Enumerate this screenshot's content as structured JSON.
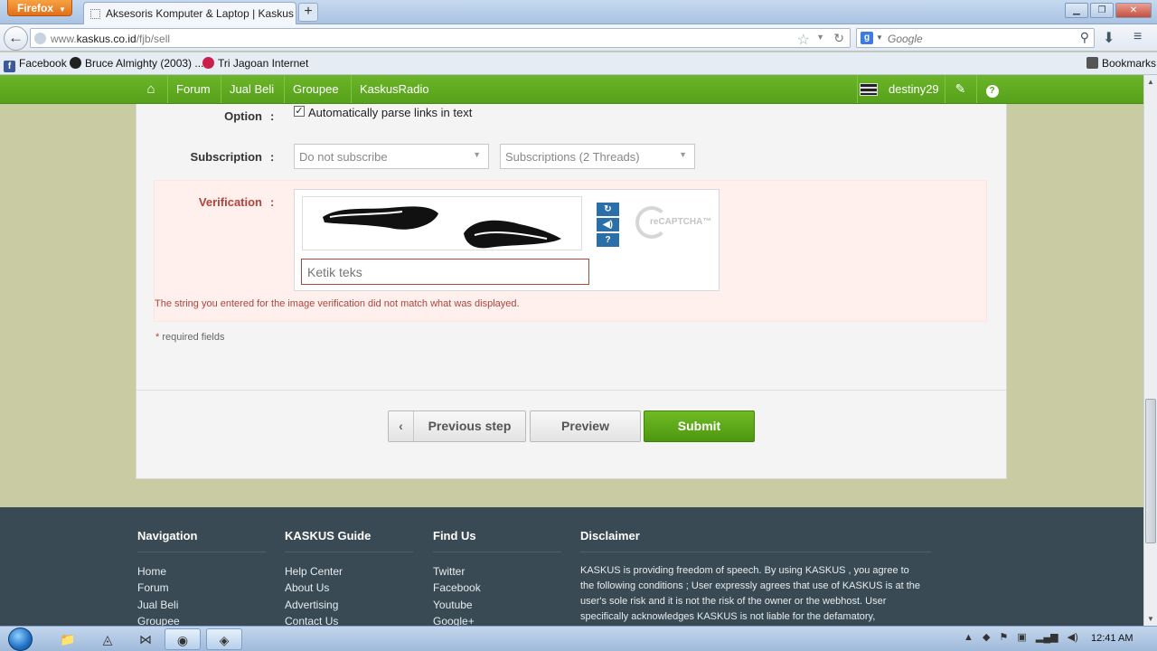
{
  "browser": {
    "menu_button": "Firefox",
    "tab_title": "Aksesoris Komputer & Laptop | Kaskus - ...",
    "new_tab": "+",
    "url_prefix": "www.",
    "url_domain": "kaskus.co.id",
    "url_path": "/fjb/sell",
    "search_placeholder": "Google",
    "bookmarks": [
      "Facebook",
      "Bruce Almighty (2003) ...",
      "Tri Jagoan Internet"
    ],
    "bookmarks_menu": "Bookmarks"
  },
  "site_nav": {
    "items": [
      "Forum",
      "Jual Beli",
      "Groupee",
      "KaskusRadio"
    ],
    "username": "destiny29"
  },
  "form": {
    "option_label": "Option",
    "option_checkbox_label": "Automatically parse links in text",
    "option_checked": true,
    "subscription_label": "Subscription",
    "subscription_select": "Do not subscribe",
    "subscriptions_select": "Subscriptions (2 Threads)",
    "verification_label": "Verification",
    "colon": ":",
    "captcha_brand": "reCAPTCHA™",
    "captcha_placeholder": "Ketik teks",
    "captcha_error": "The string you entered for the image verification did not match what was displayed.",
    "required_star": "*",
    "required_note": "required fields"
  },
  "buttons": {
    "previous": "Previous step",
    "preview": "Preview",
    "submit": "Submit"
  },
  "footer": {
    "navigation": {
      "title": "Navigation",
      "links": [
        "Home",
        "Forum",
        "Jual Beli",
        "Groupee"
      ]
    },
    "guide": {
      "title": "KASKUS Guide",
      "links": [
        "Help Center",
        "About Us",
        "Advertising",
        "Contact Us"
      ]
    },
    "find_us": {
      "title": "Find Us",
      "links": [
        "Twitter",
        "Facebook",
        "Youtube",
        "Google+"
      ]
    },
    "disclaimer": {
      "title": "Disclaimer",
      "text": "KASKUS is providing freedom of speech. By using KASKUS , you agree to the following conditions ; User expressly agrees that use of KASKUS is at the user's sole risk and it is not the risk of the owner or the webhost. User specifically acknowledges KASKUS is not liable for the defamatory,"
    }
  },
  "taskbar": {
    "clock": "12:41 AM"
  },
  "colors": {
    "kaskus_green": "#56a11a",
    "error_red": "#b0433a",
    "footer_bg": "#394a54"
  }
}
